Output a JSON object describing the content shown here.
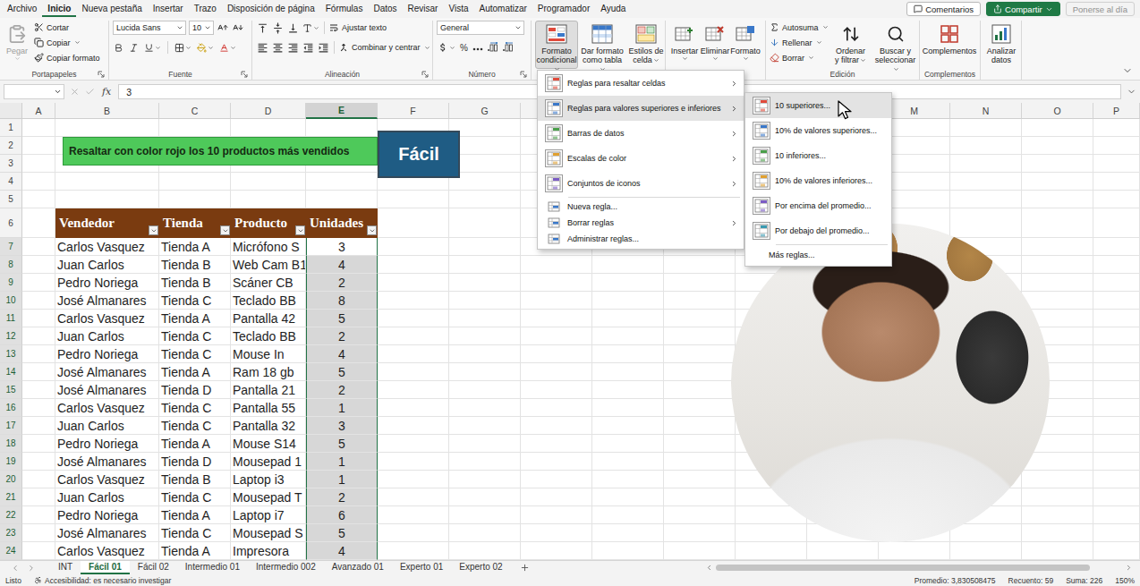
{
  "menu_bar": {
    "tabs": [
      {
        "label": "Archivo",
        "selected": false
      },
      {
        "label": "Inicio",
        "selected": true
      },
      {
        "label": "Nueva pestaña",
        "selected": false
      },
      {
        "label": "Insertar",
        "selected": false
      },
      {
        "label": "Trazo",
        "selected": false
      },
      {
        "label": "Disposición de página",
        "selected": false
      },
      {
        "label": "Fórmulas",
        "selected": false
      },
      {
        "label": "Datos",
        "selected": false
      },
      {
        "label": "Revisar",
        "selected": false
      },
      {
        "label": "Vista",
        "selected": false
      },
      {
        "label": "Automatizar",
        "selected": false
      },
      {
        "label": "Programador",
        "selected": false
      },
      {
        "label": "Ayuda",
        "selected": false
      }
    ],
    "comments": "Comentarios",
    "share": "Compartir",
    "catch_up": {
      "label": "Ponerse al día",
      "disabled": true
    }
  },
  "ribbon": {
    "clipboard": {
      "paste": {
        "label": "Pegar",
        "disabled": true
      },
      "cut": "Cortar",
      "copy": "Copiar",
      "format_painter": "Copiar formato",
      "label": "Portapapeles"
    },
    "font": {
      "name": "Lucida Sans",
      "size": "10",
      "label": "Fuente"
    },
    "alignment": {
      "wrap": "Ajustar texto",
      "merge": "Combinar y centrar",
      "label": "Alineación"
    },
    "number": {
      "format": "General",
      "percent": "%",
      "label": "Número"
    },
    "styles": [
      {
        "label": "Formato condicional",
        "pressed": true
      },
      {
        "label": "Dar formato como tabla",
        "pressed": false
      },
      {
        "label": "Estilos de celda",
        "pressed": false
      }
    ],
    "cells": [
      "Insertar",
      "Eliminar",
      "Formato"
    ],
    "editing": {
      "small": [
        "Autosuma",
        "Rellenar",
        "Borrar"
      ],
      "big": [
        "Ordenar y filtrar",
        "Buscar y seleccionar"
      ],
      "label": "Edición"
    },
    "addins": {
      "button": "Complementos",
      "label": "Complementos"
    },
    "analyze": "Analizar datos"
  },
  "formula_bar": {
    "fx": "fx",
    "value": "3"
  },
  "sheet": {
    "columns": [
      {
        "label": "A",
        "selected": false
      },
      {
        "label": "B",
        "selected": false
      },
      {
        "label": "C",
        "selected": false
      },
      {
        "label": "D",
        "selected": false
      },
      {
        "label": "E",
        "selected": true
      },
      {
        "label": "F",
        "selected": false
      },
      {
        "label": "G",
        "selected": false
      },
      {
        "label": "",
        "selected": false
      },
      {
        "label": "",
        "selected": false
      },
      {
        "label": "",
        "selected": false
      },
      {
        "label": "",
        "selected": false
      },
      {
        "label": "",
        "selected": false
      },
      {
        "label": "M",
        "selected": false
      },
      {
        "label": "N",
        "selected": false
      },
      {
        "label": "O",
        "selected": false
      },
      {
        "label": "P",
        "selected": false
      }
    ],
    "blank_rows": [
      "1",
      "2",
      "3",
      "4",
      "5"
    ]
  },
  "task_banner": {
    "text": "Resaltar con color rojo los 10 productos más vendidos",
    "level": "Fácil"
  },
  "table": {
    "header_row": "6",
    "columns": [
      "Vendedor",
      "Tienda",
      "Producto",
      "Unidades"
    ],
    "rows": [
      {
        "row": "7",
        "vendedor": "Carlos Vasquez",
        "tienda": "Tienda A",
        "producto": "Micrófono S",
        "unidades": "3",
        "selected": true,
        "active": true
      },
      {
        "row": "8",
        "vendedor": "Juan Carlos",
        "tienda": "Tienda B",
        "producto": "Web Cam B1",
        "unidades": "4",
        "selected": true,
        "active": false
      },
      {
        "row": "9",
        "vendedor": "Pedro Noriega",
        "tienda": "Tienda B",
        "producto": "Scáner CB",
        "unidades": "2",
        "selected": true,
        "active": false
      },
      {
        "row": "10",
        "vendedor": "José Almanares",
        "tienda": "Tienda C",
        "producto": "Teclado BB",
        "unidades": "8",
        "selected": true,
        "active": false
      },
      {
        "row": "11",
        "vendedor": "Carlos Vasquez",
        "tienda": "Tienda A",
        "producto": "Pantalla 42",
        "unidades": "5",
        "selected": true,
        "active": false
      },
      {
        "row": "12",
        "vendedor": "Juan Carlos",
        "tienda": "Tienda C",
        "producto": "Teclado BB",
        "unidades": "2",
        "selected": true,
        "active": false
      },
      {
        "row": "13",
        "vendedor": "Pedro Noriega",
        "tienda": "Tienda C",
        "producto": "Mouse In",
        "unidades": "4",
        "selected": true,
        "active": false
      },
      {
        "row": "14",
        "vendedor": "José Almanares",
        "tienda": "Tienda A",
        "producto": "Ram 18 gb",
        "unidades": "5",
        "selected": true,
        "active": false
      },
      {
        "row": "15",
        "vendedor": "José Almanares",
        "tienda": "Tienda D",
        "producto": "Pantalla 21",
        "unidades": "2",
        "selected": true,
        "active": false
      },
      {
        "row": "16",
        "vendedor": "Carlos Vasquez",
        "tienda": "Tienda C",
        "producto": "Pantalla 55",
        "unidades": "1",
        "selected": true,
        "active": false
      },
      {
        "row": "17",
        "vendedor": "Juan Carlos",
        "tienda": "Tienda C",
        "producto": "Pantalla 32",
        "unidades": "3",
        "selected": true,
        "active": false
      },
      {
        "row": "18",
        "vendedor": "Pedro Noriega",
        "tienda": "Tienda A",
        "producto": "Mouse S14",
        "unidades": "5",
        "selected": true,
        "active": false
      },
      {
        "row": "19",
        "vendedor": "José Almanares",
        "tienda": "Tienda D",
        "producto": "Mousepad 1",
        "unidades": "1",
        "selected": true,
        "active": false
      },
      {
        "row": "20",
        "vendedor": "Carlos Vasquez",
        "tienda": "Tienda B",
        "producto": "Laptop i3",
        "unidades": "1",
        "selected": true,
        "active": false
      },
      {
        "row": "21",
        "vendedor": "Juan Carlos",
        "tienda": "Tienda C",
        "producto": "Mousepad T",
        "unidades": "2",
        "selected": true,
        "active": false
      },
      {
        "row": "22",
        "vendedor": "Pedro Noriega",
        "tienda": "Tienda A",
        "producto": "Laptop i7",
        "unidades": "6",
        "selected": true,
        "active": false
      },
      {
        "row": "23",
        "vendedor": "José Almanares",
        "tienda": "Tienda C",
        "producto": "Mousepad S",
        "unidades": "5",
        "selected": true,
        "active": false
      },
      {
        "row": "24",
        "vendedor": "Carlos Vasquez",
        "tienda": "Tienda A",
        "producto": "Impresora",
        "unidades": "4",
        "selected": true,
        "active": false
      }
    ]
  },
  "context_menu": {
    "items": [
      {
        "label": "Reglas para resaltar celdas",
        "kind": "rule",
        "submenu": true,
        "highlighted": false
      },
      {
        "label": "Reglas para valores superiores e inferiores",
        "kind": "rule",
        "submenu": true,
        "highlighted": true
      },
      {
        "label": "Barras de datos",
        "kind": "rule",
        "submenu": true,
        "highlighted": false
      },
      {
        "label": "Escalas de color",
        "kind": "rule",
        "submenu": true,
        "highlighted": false
      },
      {
        "label": "Conjuntos de iconos",
        "kind": "rule",
        "submenu": true,
        "highlighted": false
      },
      {
        "label": "Nueva regla...",
        "kind": "action",
        "submenu": false,
        "highlighted": false
      },
      {
        "label": "Borrar reglas",
        "kind": "action",
        "submenu": true,
        "highlighted": false
      },
      {
        "label": "Administrar reglas...",
        "kind": "action",
        "submenu": false,
        "highlighted": false
      }
    ]
  },
  "submenu": {
    "items": [
      {
        "label": "10 superiores...",
        "kind": "rule",
        "highlighted": true
      },
      {
        "label": "10% de valores superiores...",
        "kind": "rule",
        "highlighted": false
      },
      {
        "label": "10 inferiores...",
        "kind": "rule",
        "highlighted": false
      },
      {
        "label": "10% de valores inferiores...",
        "kind": "rule",
        "highlighted": false
      },
      {
        "label": "Por encima del promedio...",
        "kind": "rule",
        "highlighted": false
      },
      {
        "label": "Por debajo del promedio...",
        "kind": "rule",
        "highlighted": false
      },
      {
        "label": "Más reglas...",
        "kind": "more",
        "highlighted": false
      }
    ]
  },
  "sheet_tabs": [
    {
      "label": "INT",
      "selected": false
    },
    {
      "label": "Fácil 01",
      "selected": true
    },
    {
      "label": "Fácil 02",
      "selected": false
    },
    {
      "label": "Intermedio 01",
      "selected": false
    },
    {
      "label": "Intermedio 002",
      "selected": false
    },
    {
      "label": "Avanzado 01",
      "selected": false
    },
    {
      "label": "Experto 01",
      "selected": false
    },
    {
      "label": "Experto 02",
      "selected": false
    }
  ],
  "status_bar": {
    "mode": "Listo",
    "accessibility": "Accesibilidad: es necesario investigar",
    "average": "Promedio: 3,830508475",
    "count": "Recuento: 59",
    "sum": "Suma: 226",
    "zoom": "150%"
  }
}
